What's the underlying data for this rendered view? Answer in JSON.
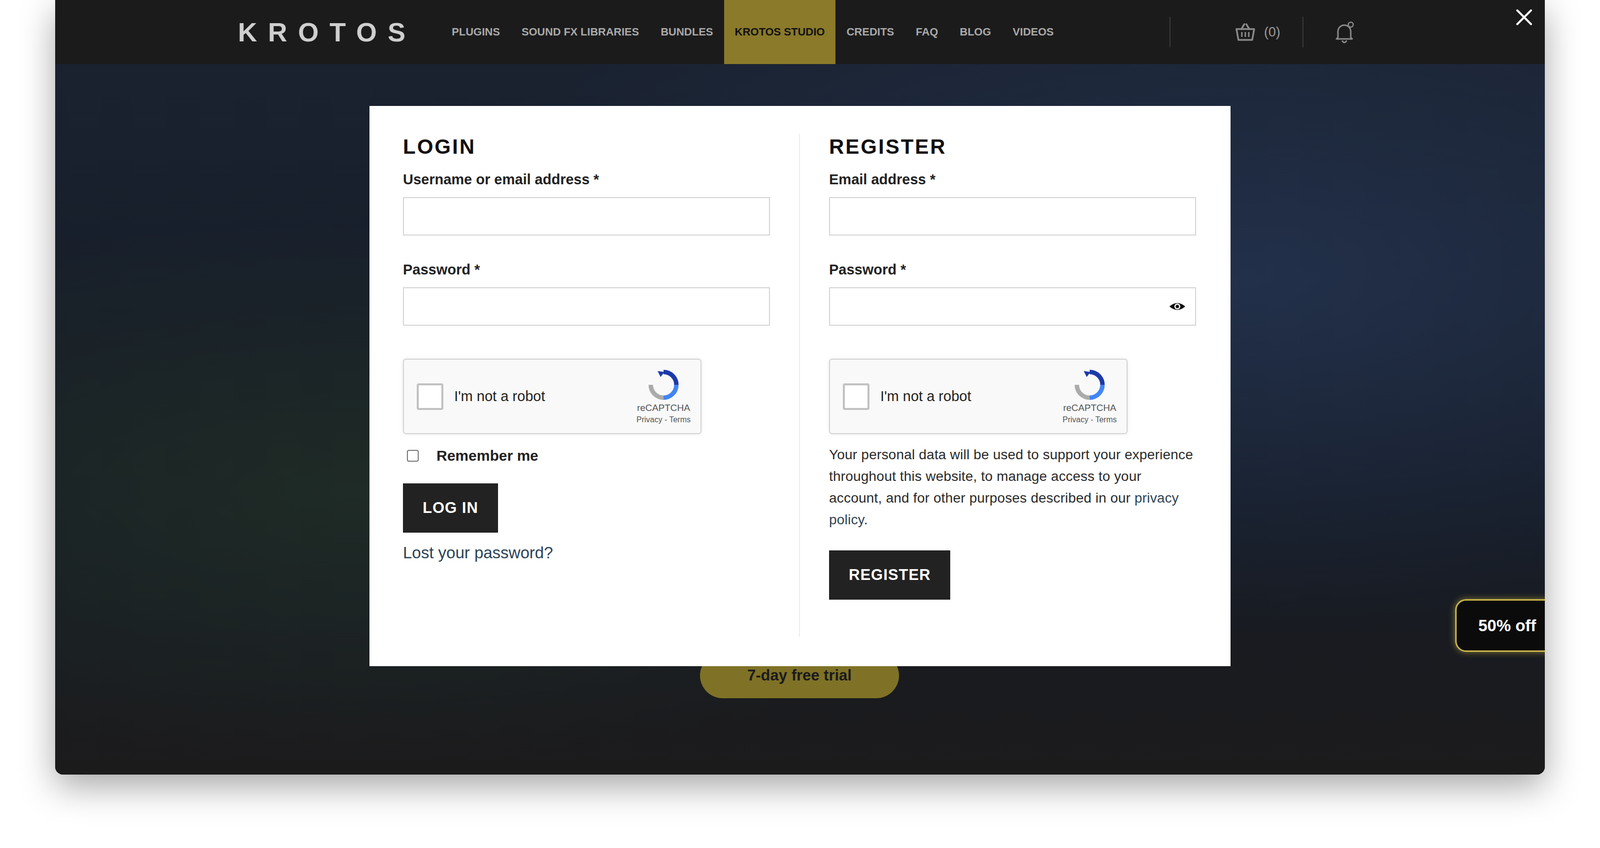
{
  "logo": "KROTOS",
  "nav": [
    {
      "label": "PLUGINS",
      "selected": false
    },
    {
      "label": "SOUND FX LIBRARIES",
      "selected": false
    },
    {
      "label": "BUNDLES",
      "selected": false
    },
    {
      "label": "KROTOS STUDIO",
      "selected": true
    },
    {
      "label": "CREDITS",
      "selected": false
    },
    {
      "label": "FAQ",
      "selected": false
    },
    {
      "label": "BLOG",
      "selected": false
    },
    {
      "label": "VIDEOS",
      "selected": false
    }
  ],
  "cart": {
    "count": "(0)"
  },
  "login": {
    "title": "LOGIN",
    "username_label": "Username or email address *",
    "password_label": "Password *",
    "captcha": {
      "label": "I'm not a robot",
      "brand": "reCAPTCHA",
      "links": "Privacy - Terms",
      "checked": false
    },
    "remember": {
      "label": "Remember me",
      "checked": false
    },
    "button": "LOG IN",
    "lost": "Lost your password?"
  },
  "register": {
    "title": "REGISTER",
    "email_label": "Email address *",
    "password_label": "Password *",
    "captcha": {
      "label": "I'm not a robot",
      "brand": "reCAPTCHA",
      "links": "Privacy - Terms",
      "checked": false
    },
    "privacy_text": "Your personal data will be used to support your experience throughout this website, to manage access to your account, and for other purposes described in our ",
    "privacy_link": "privacy policy",
    "privacy_end": ".",
    "button": "REGISTER"
  },
  "trial": "7-day free trial",
  "badge": "50% off"
}
